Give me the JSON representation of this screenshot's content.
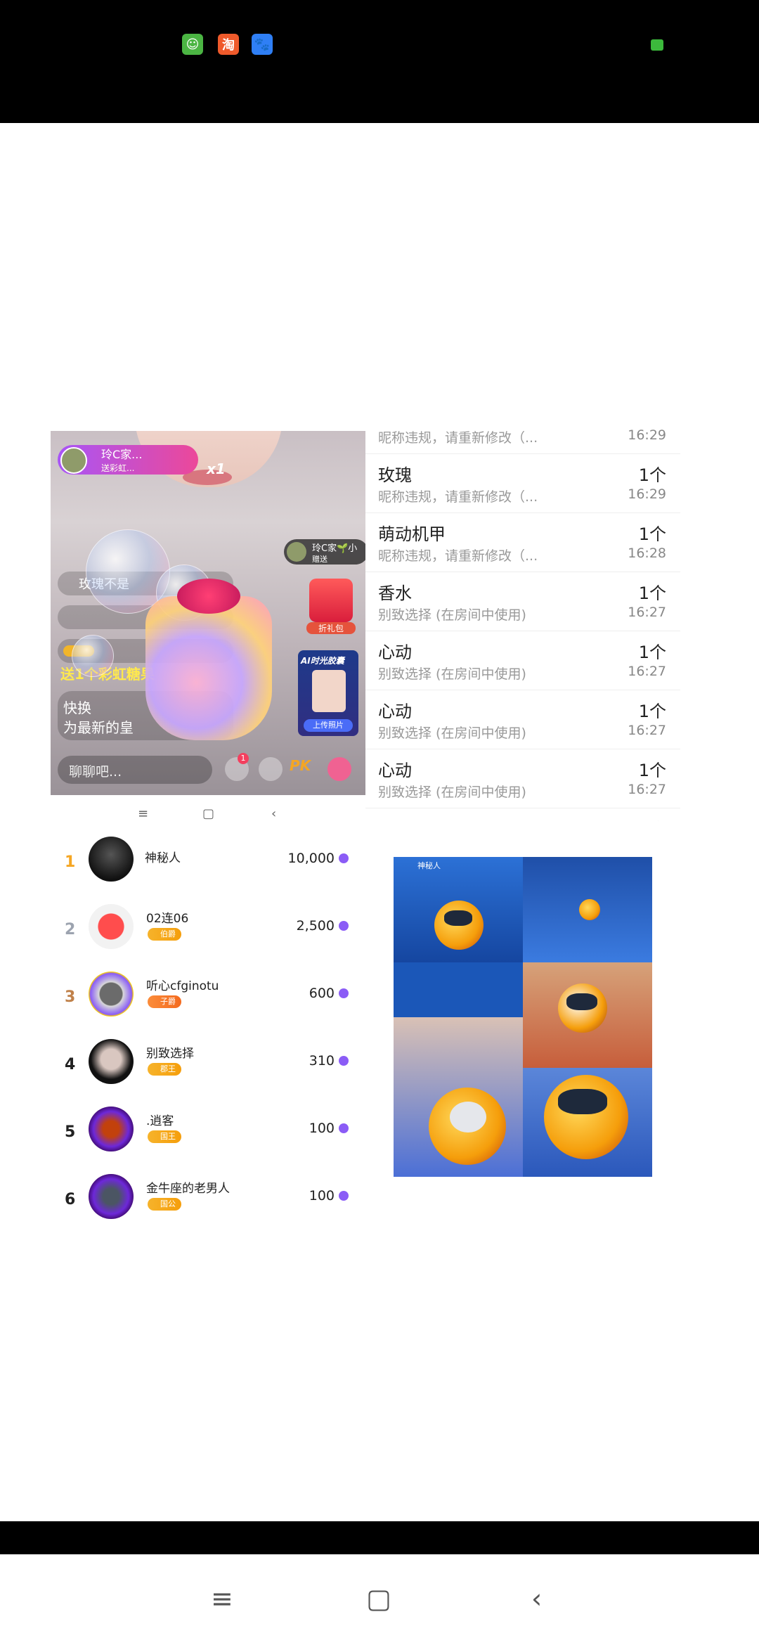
{
  "status_bar": {
    "icons": [
      "app-green-icon",
      "taobao-icon",
      "baidu-icon",
      "video-record-icon"
    ],
    "taobao_glyph": "淘"
  },
  "live_room": {
    "gift_banner": {
      "name": "玲C家...",
      "sub": "送彩虹...",
      "multiplier": "x1"
    },
    "chat_lines": [
      "玫瑰不是",
      "送1个彩虹糖果",
      "快换",
      "为最新的皇"
    ],
    "right_pill": {
      "name": "玲C家🌱小",
      "sub": "赠送"
    },
    "gift_box_label": "折礼包",
    "ai_card": {
      "title": "AI时光胶囊",
      "button": "上传照片"
    },
    "input_placeholder": "聊聊吧...",
    "notification_count": "1",
    "pk_label": "PK"
  },
  "mini_nav": {
    "menu": "≡",
    "home": "▢",
    "back": "‹"
  },
  "records": {
    "top_partial": {
      "sub": "昵称违规，请重新修改（...",
      "time": "16:29"
    },
    "items": [
      {
        "name": "玫瑰",
        "sub": "昵称违规，请重新修改（...",
        "count": "1个",
        "time": "16:29"
      },
      {
        "name": "萌动机甲",
        "sub": "昵称违规，请重新修改（...",
        "count": "1个",
        "time": "16:28"
      },
      {
        "name": "香水",
        "sub": "别致选择 (在房间中使用)",
        "count": "1个",
        "time": "16:27"
      },
      {
        "name": "心动",
        "sub": "别致选择 (在房间中使用)",
        "count": "1个",
        "time": "16:27"
      },
      {
        "name": "心动",
        "sub": "别致选择 (在房间中使用)",
        "count": "1个",
        "time": "16:27"
      },
      {
        "name": "心动",
        "sub": "别致选择 (在房间中使用)",
        "count": "1个",
        "time": "16:27"
      }
    ],
    "bottom_partial": {
      "name": "心动",
      "count": "1个"
    }
  },
  "ranking": [
    {
      "rank": "1",
      "name": "神秘人",
      "badge": "",
      "score": "10,000",
      "rank_color": "#f5a623"
    },
    {
      "rank": "2",
      "name": "02连06",
      "badge": "伯爵",
      "score": "2,500",
      "rank_color": "#9ca3af"
    },
    {
      "rank": "3",
      "name": "听心cfginotu",
      "badge": "子爵",
      "score": "600",
      "rank_color": "#c0814a"
    },
    {
      "rank": "4",
      "name": "别致选择",
      "badge": "郡王",
      "score": "310",
      "rank_color": "#222222"
    },
    {
      "rank": "5",
      "name": ".逍客",
      "badge": "国王",
      "score": "100",
      "rank_color": "#222222"
    },
    {
      "rank": "6",
      "name": "金牛座的老男人",
      "badge": "国公",
      "score": "100",
      "rank_color": "#222222"
    }
  ],
  "collage": {
    "tile_top_name": "神秘人"
  },
  "bottom_nav": {
    "menu": "≡",
    "home": "▢",
    "back": "‹"
  }
}
